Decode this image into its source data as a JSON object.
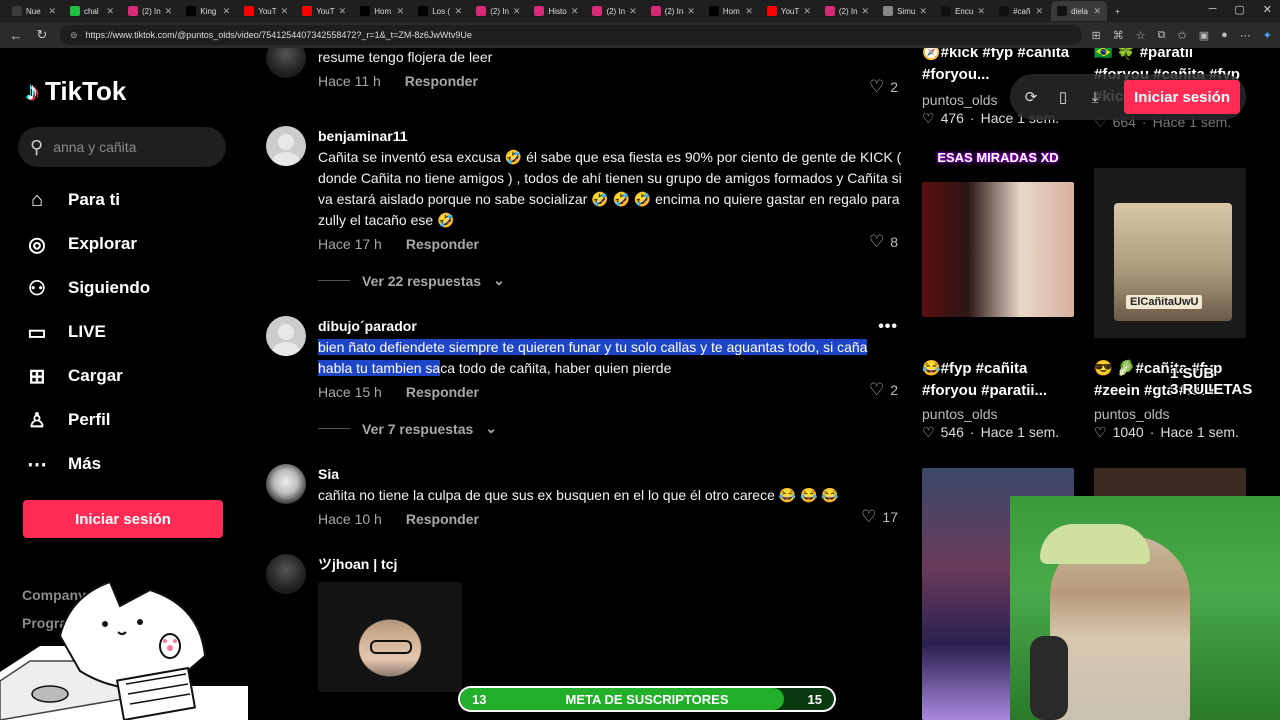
{
  "browser": {
    "tabs": [
      {
        "label": "Nue",
        "color": "#3b3b3b",
        "active": false
      },
      {
        "label": "chal",
        "color": "#20c040",
        "active": false
      },
      {
        "label": "(2) In",
        "color": "#d62976",
        "active": false
      },
      {
        "label": "King",
        "color": "#000000",
        "active": false
      },
      {
        "label": "YouT",
        "color": "#ff0000",
        "active": false
      },
      {
        "label": "YouT",
        "color": "#ff0000",
        "active": false
      },
      {
        "label": "Hom",
        "color": "#000000",
        "active": false
      },
      {
        "label": "Los (",
        "color": "#000000",
        "active": false
      },
      {
        "label": "(2) In",
        "color": "#d62976",
        "active": false
      },
      {
        "label": "Histo",
        "color": "#d62976",
        "active": false
      },
      {
        "label": "(2) In",
        "color": "#d62976",
        "active": false
      },
      {
        "label": "(2) In",
        "color": "#d62976",
        "active": false
      },
      {
        "label": "Hom",
        "color": "#000000",
        "active": false
      },
      {
        "label": "YouT",
        "color": "#ff0000",
        "active": false
      },
      {
        "label": "(2) In",
        "color": "#d62976",
        "active": false
      },
      {
        "label": "Simu",
        "color": "#888888",
        "active": false
      },
      {
        "label": "Encu",
        "color": "#111111",
        "active": false
      },
      {
        "label": "#cañ",
        "color": "#111111",
        "active": false
      },
      {
        "label": "diela",
        "color": "#111111",
        "active": true
      }
    ],
    "url": "https://www.tiktok.com/@puntos_olds/video/7541254407342558472?_r=1&_t=ZM-8z6JwWtv9Ue"
  },
  "sidebar": {
    "logo_text": "TikTok",
    "search_placeholder": "anna y cañita",
    "items": [
      {
        "label": "Para ti",
        "icon": "home-icon"
      },
      {
        "label": "Explorar",
        "icon": "compass-icon"
      },
      {
        "label": "Siguiendo",
        "icon": "following-icon"
      },
      {
        "label": "LIVE",
        "icon": "live-icon"
      },
      {
        "label": "Cargar",
        "icon": "upload-icon"
      },
      {
        "label": "Perfil",
        "icon": "profile-icon"
      },
      {
        "label": "Más",
        "icon": "more-icon"
      }
    ],
    "login_label": "Iniciar sesión",
    "footer": [
      "Company",
      "Progra"
    ]
  },
  "comments": [
    {
      "username": "",
      "text": "resume tengo flojera de leer",
      "time": "Hace 11 h",
      "reply": "Responder",
      "likes": "2"
    },
    {
      "username": "benjaminar11",
      "text": "Cañita se inventó esa excusa 🤣 él sabe que esa fiesta es 90% por ciento de gente de KICK ( donde Cañita no tiene amigos ) , todos de ahí tienen su grupo de amigos formados y Cañita si va estará aislado porque no sabe socializar 🤣 🤣 🤣 encima no quiere gastar en regalo para zully el tacaño ese 🤣",
      "time": "Hace 17 h",
      "reply": "Responder",
      "likes": "8",
      "view_replies": "Ver 22 respuestas"
    },
    {
      "username": "dibujo´parador",
      "text_highlighted": "bien ñato defiendete siempre te quieren funar y tu solo callas y te aguantas todo, si caña habla tu tambien sa",
      "text_rest": "ca todo de cañita, haber quien pierde",
      "time": "Hace 15 h",
      "reply": "Responder",
      "likes": "2",
      "view_replies": "Ver 7 respuestas"
    },
    {
      "username": "Sia",
      "text": "cañita no tiene la culpa de que sus ex busquen en el lo que él otro carece 😂 😂 😂",
      "time": "Hace 10 h",
      "reply": "Responder",
      "likes": "17"
    },
    {
      "username": "ツjhoan | tcj"
    }
  ],
  "videos": [
    {
      "title": "🧭#kick #fyp #cañita #foryou...",
      "user": "puntos_olds",
      "likes": "476",
      "age": "Hace 1 sem."
    },
    {
      "title": "🇧🇷 🍀 #paratii #foryou #cañita #fyp #kick...",
      "user": "puntos_olds",
      "likes": "664",
      "age": "Hace 1 sem."
    },
    {
      "title": "😂#fyp #cañita #foryou #paratii...",
      "user": "puntos_olds",
      "likes": "546",
      "age": "Hace 1 sem.",
      "thumb_label": "ESAS MIRADAS XD"
    },
    {
      "title": "😎 🥬#cañita #fyp #zeein #gta #kick...",
      "user": "puntos_olds",
      "likes": "1040",
      "age": "Hace 1 sem.",
      "thumb_label": "ElCañitaUwU"
    }
  ],
  "topbar": {
    "login_label": "Iniciar sesión"
  },
  "overlay": {
    "stream_text_1": "1 SUB",
    "stream_text_2": "3 RULETAS",
    "goal_label": "META DE SUSCRIPTORES",
    "goal_current": "13",
    "goal_target": "15",
    "goal_fraction": 0.8667
  }
}
